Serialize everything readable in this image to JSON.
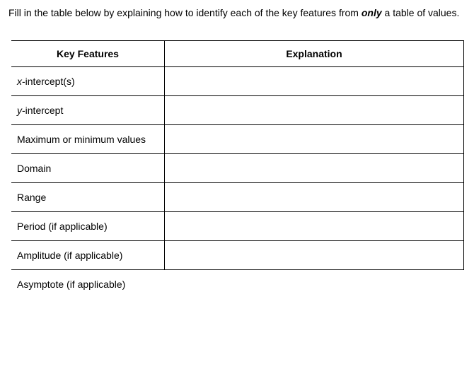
{
  "instruction": {
    "pre": "Fill in the table below by explaining how to identify each of the key features from ",
    "emph": "only",
    "post": " a table of values."
  },
  "headers": {
    "key": "Key Features",
    "exp": "Explanation"
  },
  "rows": [
    {
      "var": "x",
      "rest": "-intercept(s)",
      "exp": ""
    },
    {
      "var": "y",
      "rest": "-intercept",
      "exp": ""
    },
    {
      "var": "",
      "rest": "Maximum or minimum values",
      "exp": ""
    },
    {
      "var": "",
      "rest": "Domain",
      "exp": ""
    },
    {
      "var": "",
      "rest": "Range",
      "exp": ""
    },
    {
      "var": "",
      "rest": "Period (if applicable)",
      "exp": ""
    },
    {
      "var": "",
      "rest": "Amplitude (if applicable)",
      "exp": ""
    },
    {
      "var": "",
      "rest": "Asymptote (if applicable)",
      "exp": ""
    }
  ]
}
